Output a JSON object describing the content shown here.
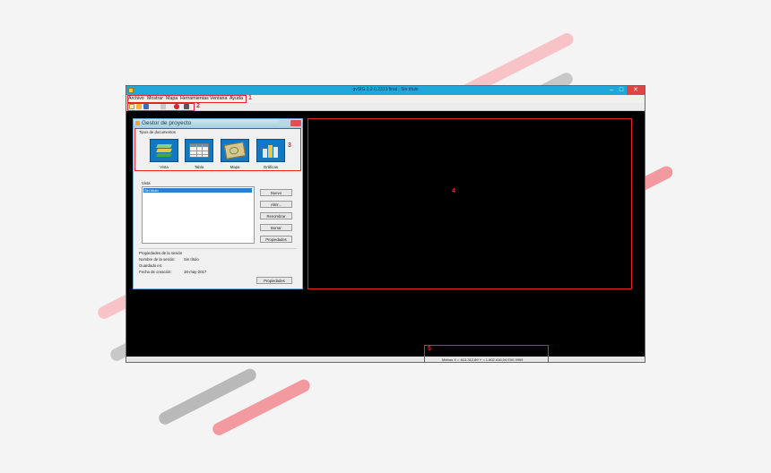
{
  "window": {
    "title": "gvSIG 2.2.0.2313 final : Sin título",
    "minimize_glyph": "–",
    "maximize_glyph": "□",
    "close_glyph": "✕"
  },
  "menu": {
    "items": [
      "Archivo",
      "Mostrar",
      "Mapa",
      "Herramientas",
      "Ventana",
      "Ayuda"
    ]
  },
  "toolbar": {
    "icons": [
      "new-project-icon",
      "open-project-icon",
      "save-project-icon",
      "zoom-icon",
      "help-icon",
      "settings-icon"
    ]
  },
  "annotations": {
    "m1": "1",
    "m2": "2",
    "m3": "3",
    "m4": "4",
    "m5": "5",
    "color": "#e8212b"
  },
  "gestor": {
    "title": "Gestor de proyecto",
    "doc_types_label": "Tipos de documentos",
    "doc_types": [
      {
        "label": "Vista",
        "icon": "layers-icon"
      },
      {
        "label": "Tabla",
        "icon": "table-icon"
      },
      {
        "label": "Mapa",
        "icon": "map-icon"
      },
      {
        "label": "Gráficas",
        "icon": "chart-icon"
      }
    ],
    "list_label": "Vista",
    "list_items": [
      "Sin título"
    ],
    "buttons": {
      "nuevo": "Nuevo",
      "abrir": "Abrir...",
      "renombrar": "Renombrar",
      "borrar": "Borrar",
      "propiedades": "Propiedades"
    },
    "session": {
      "heading": "Propiedades de la sesión",
      "name_label": "Nombre de la sesión:",
      "name_value": "Sin título",
      "saved_label": "Guardado en:",
      "saved_value": "",
      "date_label": "Fecha de creación:",
      "date_value": "18-may-2017",
      "props_button": "Propiedades"
    }
  },
  "statusbar": {
    "coordinates": "Metros X = 613.312,89 Y = 1.602.416,04 E00.9999"
  },
  "colors": {
    "titlebar": "#1ea7db",
    "workspace": "#000000",
    "doc_button": "#1378c2",
    "selection": "#2f7fcc"
  }
}
